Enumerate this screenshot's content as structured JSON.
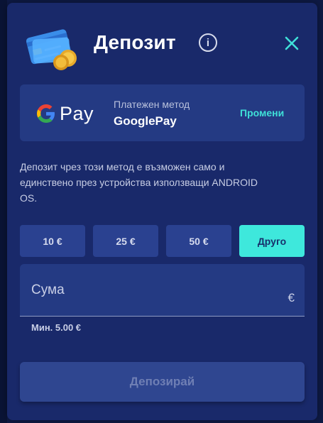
{
  "modal": {
    "title": "Депозит",
    "icons": {
      "card": "credit-card-coins-icon",
      "info": "info-icon",
      "close": "close-icon"
    }
  },
  "payment_method": {
    "logo_text": "Pay",
    "label": "Платежен метод",
    "name": "GooglePay",
    "change_label": "Промени"
  },
  "notice": "Депозит чрез този метод е възможен само и единствено през устройства използващи ANDROID OS.",
  "amounts": [
    {
      "label": "10 €",
      "active": false
    },
    {
      "label": "25 €",
      "active": false
    },
    {
      "label": "50 €",
      "active": false
    },
    {
      "label": "Друго",
      "active": true
    }
  ],
  "sum_field": {
    "label": "Сума",
    "currency": "€",
    "min_text": "Мин. 5.00 €"
  },
  "deposit_button": "Депозирай",
  "colors": {
    "modal_bg": "#19296a",
    "card_bg": "#243a83",
    "accent": "#3ee8dc",
    "button_disabled": "#2f4690"
  }
}
